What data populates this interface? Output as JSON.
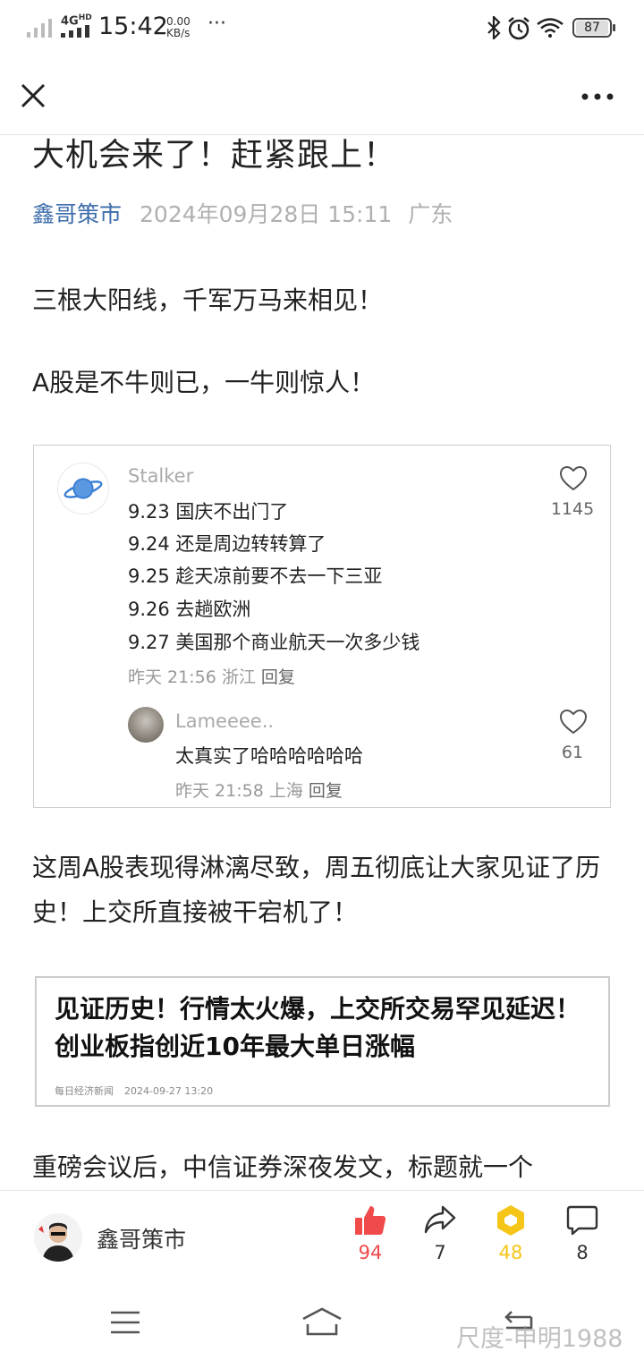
{
  "status_bar": {
    "network": "4G",
    "network_sup": "HD",
    "time": "15:42",
    "speed_value": "0.00",
    "speed_unit": "KB/s",
    "more": "···",
    "battery": "87"
  },
  "article": {
    "title": "大机会来了！赶紧跟上！",
    "author": "鑫哥策市",
    "date": "2024年09月28日 15:11",
    "location": "广东",
    "paragraphs": [
      "三根大阳线，千军万马来相见！",
      "A股是不牛则已，一牛则惊人！",
      "这周A股表现得淋漓尽致，周五彻底让大家见证了历史！上交所直接被干宕机了！",
      "重磅会议后，中信证券深夜发文，标题就一个"
    ]
  },
  "comment": {
    "user": "Stalker",
    "lines": [
      "9.23 国庆不出门了",
      "9.24 还是周边转转算了",
      "9.25 趁天凉前要不去一下三亚",
      "9.26 去趟欧洲",
      "9.27 美国那个商业航天一次多少钱"
    ],
    "meta": "昨天 21:56 浙江",
    "reply": "回复",
    "likes": "1145",
    "sub_reply": {
      "user": "Lameeee..",
      "text": "太真实了哈哈哈哈哈哈",
      "meta": "昨天 21:58 上海",
      "reply": "回复",
      "likes": "61"
    }
  },
  "news_card": {
    "title": "见证历史！行情太火爆，上交所交易罕见延迟！创业板指创近10年最大单日涨幅",
    "source": "每日经济新闻",
    "time": "2024-09-27 13:20"
  },
  "bottom_bar": {
    "author": "鑫哥策市",
    "like_count": "94",
    "share_count": "7",
    "favorite_count": "48",
    "comment_count": "8"
  },
  "watermark": "尺度-申明1988",
  "colors": {
    "like_red": "#f04a4a",
    "favorite_yellow": "#f5c518",
    "author_blue": "#3d6dab"
  }
}
